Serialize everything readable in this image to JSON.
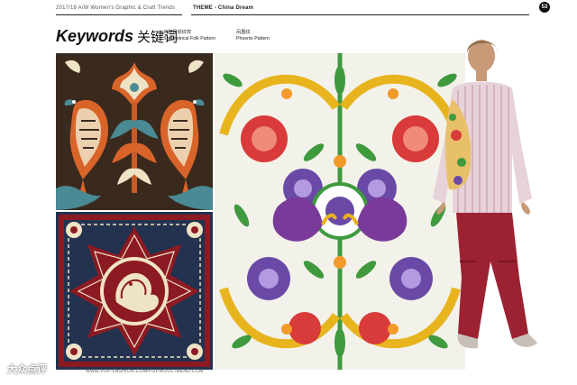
{
  "header": {
    "report": "2017/18 A/W Women's Graphic & Craft Trends",
    "theme": "THEME - China Dream",
    "page_number": "53"
  },
  "keywords": {
    "title": "Keywords",
    "title_cn": "关键词"
  },
  "labels": [
    {
      "cn": "对称民俗纹样",
      "en": "Symmetrical Folk Pattern"
    },
    {
      "cn": "凤凰纹",
      "en": "Phoenix Pattern"
    }
  ],
  "images": {
    "folk_birds": "symmetric-folk-birds-pattern",
    "mandala": "red-navy-phoenix-mandala",
    "phoenix_floral": "phoenix-floral-print",
    "model": "model-in-floral-shirt-red-trousers"
  },
  "footer": {
    "url": "WWW.POP-FASHION.COM/POPWOOLTREND.COM",
    "watermark": "大众点评"
  },
  "colors": {
    "folk_bg": "#3a2a1e",
    "folk_orange": "#d9642a",
    "folk_cream": "#efe3c6",
    "folk_teal": "#4a8a94",
    "mandala_red": "#8c1a22",
    "mandala_navy": "#23324f",
    "floral_bg": "#f3f2ea",
    "floral_green": "#3f9a3e",
    "floral_purple": "#6a4aa6",
    "floral_red": "#d93a3a",
    "trousers": "#9c2232"
  }
}
